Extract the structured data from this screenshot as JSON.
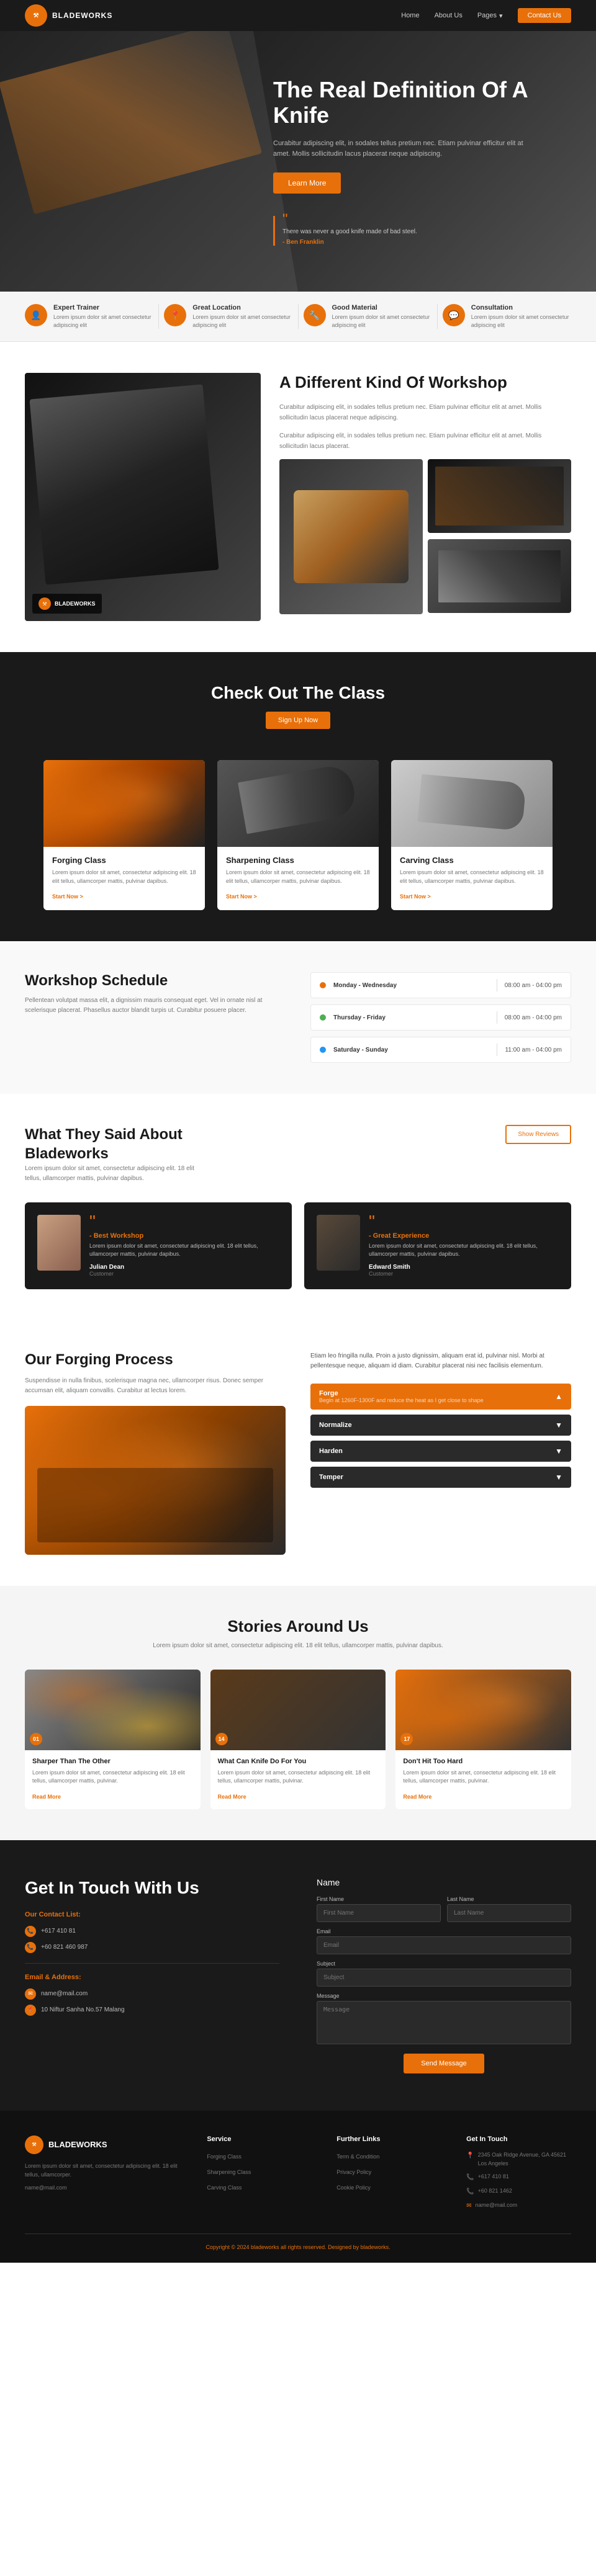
{
  "nav": {
    "logo_text": "BLADEWORKS",
    "links": [
      "Home",
      "About Us",
      "Pages",
      "Contact Us"
    ],
    "contact_btn": "Contact Us"
  },
  "hero": {
    "title": "The Real Definition Of A Knife",
    "description": "Curabitur adipiscing elit, in sodales tellus pretium nec. Etiam pulvinar efficitur elit at amet. Mollis sollicitudin lacus placerat neque adipiscing.",
    "cta_btn": "Learn More",
    "quote_text": "There was never a good knife made of bad steel.",
    "quote_author": "- Ben Franklin"
  },
  "features": [
    {
      "icon": "👤",
      "title": "Expert Trainer",
      "description": "Lorem ipsum dolor sit amet consectetur adipiscing elit"
    },
    {
      "icon": "📍",
      "title": "Great Location",
      "description": "Lorem ipsum dolor sit amet consectetur adipiscing elit"
    },
    {
      "icon": "🔧",
      "title": "Good Material",
      "description": "Lorem ipsum dolor sit amet consectetur adipiscing elit"
    },
    {
      "icon": "💬",
      "title": "Consultation",
      "description": "Lorem ipsum dolor sit amet consectetur adipiscing elit"
    }
  ],
  "workshop": {
    "title": "A Different Kind Of Workshop",
    "description1": "Curabitur adipiscing elit, in sodales tellus pretium nec. Etiam pulvinar efficitur elit at amet. Mollis sollicitudin lacus placerat neque adipiscing.",
    "description2": "Curabitur adipiscing elit, in sodales tellus pretium nec. Etiam pulvinar efficitur elit at amet. Mollis sollicitudin lacus placerat.",
    "logo": "BLADEWORKS"
  },
  "classes": {
    "section_title": "Check Out The Class",
    "cta_btn": "Sign Up Now",
    "items": [
      {
        "type": "fire",
        "title": "Forging Class",
        "description": "Lorem ipsum dolor sit amet, consectetur adipiscing elit. 18 elit tellus, ullamcorper mattis, pulvinar dapibus.",
        "link": "Start Now >"
      },
      {
        "type": "knife",
        "title": "Sharpening Class",
        "description": "Lorem ipsum dolor sit amet, consectetur adipiscing elit. 18 elit tellus, ullamcorper mattis, pulvinar dapibus.",
        "link": "Start Now >"
      },
      {
        "type": "light",
        "title": "Carving Class",
        "description": "Lorem ipsum dolor sit amet, consectetur adipiscing elit. 18 elit tellus, ullamcorper mattis, pulvinar dapibus.",
        "link": "Start Now >"
      }
    ]
  },
  "schedule": {
    "title": "Workshop Schedule",
    "description": "Pellentean volutpat massa elit, a dignissim mauris consequat eget. Vel in ornate nisl at scelerisque placerat. Phasellus auctor blandit turpis ut. Curabitur posuere placer.",
    "rows": [
      {
        "day": "Monday - Wednesday",
        "time": "08:00 am - 04:00 pm",
        "color": "#e8700a"
      },
      {
        "day": "Thursday - Friday",
        "time": "08:00 am - 04:00 pm",
        "color": "#4CAF50"
      },
      {
        "day": "Saturday - Sunday",
        "time": "11:00 am - 04:00 pm",
        "color": "#2196F3"
      }
    ]
  },
  "testimonials": {
    "title": "What They Said About Bladeworks",
    "description": "Lorem ipsum dolor sit amet, consectetur adipiscing elit. 18 elit tellus, ullamcorper mattis, pulvinar dapibus.",
    "show_reviews_btn": "Show Reviews",
    "items": [
      {
        "gender": "female",
        "tag": "- Best Workshop",
        "text": "Lorem ipsum dolor sit amet, consectetur adipiscing elit. 18 elit tellus, ullamcorper mattis, pulvinar dapibus.",
        "author": "Julian Dean",
        "role": "Customer"
      },
      {
        "gender": "male",
        "tag": "- Great Experience",
        "text": "Lorem ipsum dolor sit amet, consectetur adipiscing elit. 18 elit tellus, ullamcorper mattis, pulvinar dapibus.",
        "author": "Edward Smith",
        "role": "Customer"
      }
    ]
  },
  "forging": {
    "title": "Our Forging Process",
    "description": "Suspendisse in nulla finibus, scelerisque magna nec, ullamcorper risus. Donec semper accumsan elit, aliquam convallis. Curabitur at lectus lorem.",
    "right_text": "Etiam leo fringilla nulla. Proin a justo dignissim, aliquam erat id, pulvinar nisl. Morbi at pellentesque neque, aliquam id diam. Curabitur placerat nisi nec facilisis elementum.",
    "steps": [
      {
        "label": "Forge",
        "note": "Begin at 1260F-1300F and reduce the heat as I get close to shape",
        "active": true
      },
      {
        "label": "Normalize",
        "note": "",
        "active": false
      },
      {
        "label": "Harden",
        "note": "",
        "active": false
      },
      {
        "label": "Temper",
        "note": "",
        "active": false
      }
    ]
  },
  "stories": {
    "title": "Stories Around Us",
    "description": "Lorem ipsum dolor sit amet, consectetur adipiscing elit. 18 elit tellus, ullamcorper mattis, pulvinar dapibus.",
    "items": [
      {
        "type": "knife1",
        "number": "01",
        "title": "Sharper Than The Other",
        "description": "Lorem ipsum dolor sit amet, consectetur adipiscing elit. 18 elit tellus, ullamcorper mattis, pulvinar.",
        "link": "Read More"
      },
      {
        "type": "knife2",
        "number": "14",
        "title": "What Can Knife Do For You",
        "description": "Lorem ipsum dolor sit amet, consectetur adipiscing elit. 18 elit tellus, ullamcorper mattis, pulvinar.",
        "link": "Read More"
      },
      {
        "type": "forge",
        "number": "17",
        "title": "Don't Hit Too Hard",
        "description": "Lorem ipsum dolor sit amet, consectetur adipiscing elit. 18 elit tellus, ullamcorper mattis, pulvinar.",
        "link": "Read More"
      }
    ]
  },
  "contact": {
    "title": "Get In Touch With Us",
    "contact_info_label": "Our Contact List:",
    "phones": [
      "+617 410 81",
      "+60 821 460 987"
    ],
    "email_label": "Email & Address:",
    "email": "name@mail.com",
    "address": "10 Niftur Sanha No.57 Malang",
    "form_name": "Name",
    "fields": {
      "first_name_label": "First Name",
      "first_name_placeholder": "First Name",
      "last_name_label": "Last Name",
      "last_name_placeholder": "Last Name",
      "email_label": "Email",
      "email_placeholder": "Email",
      "subject_label": "Subject",
      "subject_placeholder": "Subject",
      "message_label": "Message",
      "message_placeholder": "Message"
    },
    "submit_btn": "Send Message"
  },
  "footer": {
    "logo": "BLADEWORKS",
    "brand_description": "Lorem ipsum dolor sit amet, consectetur adipiscing elit. 18 elit tellus, ullamcorper.",
    "brand_email": "name@mail.com",
    "service_title": "Service",
    "service_links": [
      "Forging Class",
      "Sharpening Class",
      "Carving Class"
    ],
    "further_links_title": "Further Links",
    "further_links": [
      "Term & Condition",
      "Privacy Policy",
      "Cookie Policy"
    ],
    "get_in_touch_title": "Get In Touch",
    "address": "2345 Oak Ridge Avenue, GA 45621 Los Angeles",
    "phone1": "+617 410 81",
    "phone2": "+60 821 1462",
    "email_footer": "name@mail.com",
    "copyright": "Copyright © 2024 bladeworks all rights reserved. Designed by bladeworks."
  }
}
